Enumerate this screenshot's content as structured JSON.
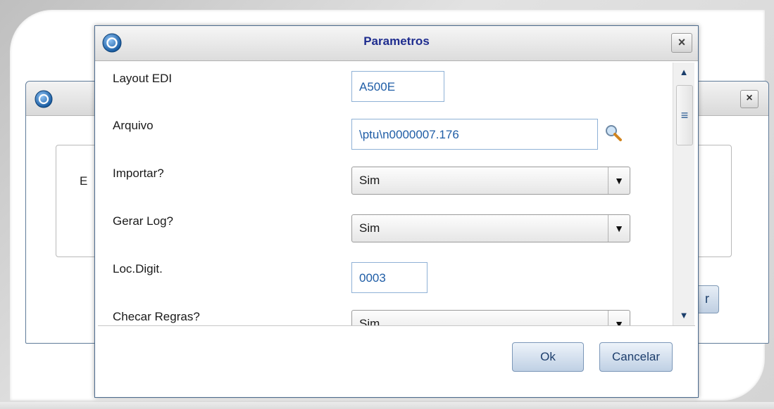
{
  "background_window": {
    "partial_text": "E",
    "close_label": "×",
    "partial_button_label": "r"
  },
  "dialog": {
    "title": "Parametros",
    "close_label": "×",
    "fields": [
      {
        "label": "Layout EDI",
        "type": "text",
        "value": "A500E"
      },
      {
        "label": "Arquivo",
        "type": "text",
        "value": "\\ptu\\n0000007.176"
      },
      {
        "label": "Importar?",
        "type": "combo",
        "value": "Sim"
      },
      {
        "label": "Gerar Log?",
        "type": "combo",
        "value": "Sim"
      },
      {
        "label": "Loc.Digit.",
        "type": "text",
        "value": "0003"
      },
      {
        "label": "Checar Regras?",
        "type": "combo",
        "value": "Sim"
      }
    ],
    "buttons": {
      "ok": "Ok",
      "cancel": "Cancelar"
    },
    "icons": {
      "logo": "totvs-logo-icon",
      "search": "magnifier-icon",
      "dropdown": "chevron-down-icon",
      "scroll_up": "arrow-up-icon",
      "scroll_down": "arrow-down-icon"
    }
  },
  "colors": {
    "title": "#1f2d8f",
    "input_text": "#1f5da6",
    "border_blue": "#4c6b8e"
  }
}
